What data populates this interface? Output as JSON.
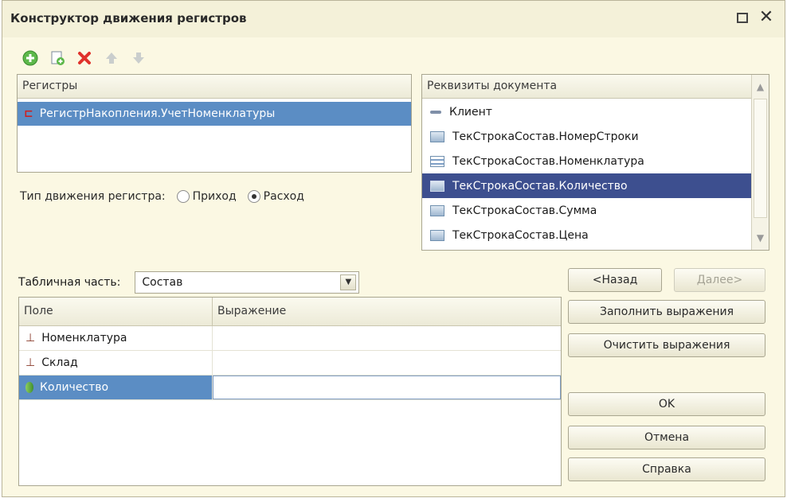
{
  "window": {
    "title": "Конструктор движения регистров"
  },
  "toolbar": {
    "icons": [
      "add-icon",
      "copy-icon",
      "delete-icon",
      "move-up-icon",
      "move-down-icon"
    ]
  },
  "registers": {
    "header": "Регистры",
    "items": [
      {
        "label": "РегистрНакопления.УчетНоменклатуры"
      }
    ]
  },
  "movement_type": {
    "label": "Тип движения регистра:",
    "options": [
      "Приход",
      "Расход"
    ],
    "selected": "Расход"
  },
  "attributes": {
    "header": "Реквизиты документа",
    "items": [
      {
        "label": "Клиент",
        "icon": "field-icon"
      },
      {
        "label": "ТекСтрокаСостав.НомерСтроки",
        "icon": "table-field-icon"
      },
      {
        "label": "ТекСтрокаСостав.Номенклатура",
        "icon": "reference-icon"
      },
      {
        "label": "ТекСтрокаСостав.Количество",
        "icon": "table-field-icon"
      },
      {
        "label": "ТекСтрокаСостав.Сумма",
        "icon": "table-field-icon"
      },
      {
        "label": "ТекСтрокаСостав.Цена",
        "icon": "table-field-icon"
      }
    ],
    "selected": "ТекСтрокаСостав.Количество"
  },
  "tabular_part": {
    "label": "Табличная часть:",
    "value": "Состав"
  },
  "grid": {
    "columns": [
      "Поле",
      "Выражение"
    ],
    "rows": [
      {
        "field": "Номенклатура",
        "expression": "",
        "icon": "dimension-icon"
      },
      {
        "field": "Склад",
        "expression": "",
        "icon": "dimension-icon"
      },
      {
        "field": "Количество",
        "expression": "",
        "icon": "resource-icon"
      }
    ]
  },
  "buttons": {
    "back": "<Назад",
    "next": "Далее>",
    "fill": "Заполнить выражения",
    "clear": "Очистить выражения",
    "ok": "OK",
    "cancel": "Отмена",
    "help": "Справка"
  },
  "colors": {
    "background": "#fbf8e3",
    "selection": "#5b8dc4",
    "selection_dark": "#3d4f8f"
  }
}
